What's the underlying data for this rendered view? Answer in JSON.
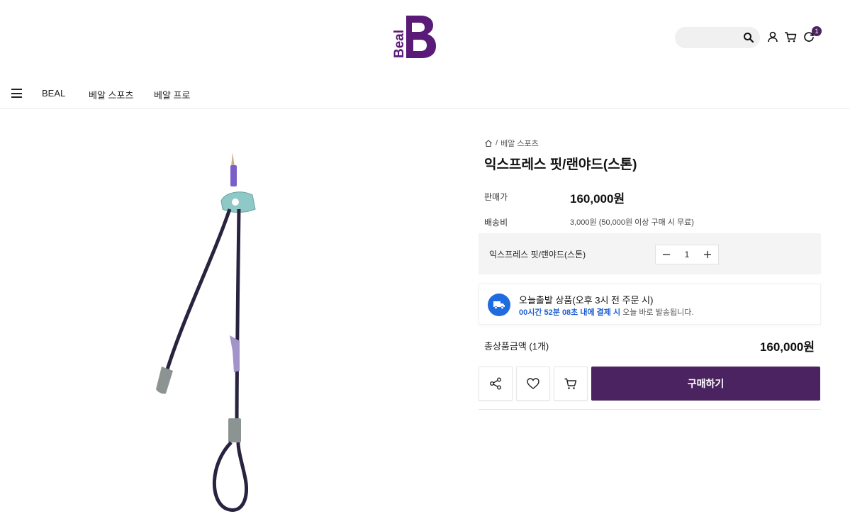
{
  "header": {
    "logo_text": "Beal",
    "search": {
      "placeholder": ""
    },
    "cart_badge": "1"
  },
  "nav": {
    "items": [
      {
        "label": "BEAL"
      },
      {
        "label": "베알 스포츠"
      },
      {
        "label": "베알 프로"
      }
    ]
  },
  "breadcrumb": {
    "separator": "/",
    "category": "베알 스포츠"
  },
  "product": {
    "title": "익스프레스 핏/랜야드(스톤)",
    "price_label": "판매가",
    "price": "160,000원",
    "shipping_label": "배송비",
    "shipping": "3,000원 (50,000원 이상 구매 시 무료)",
    "option_name": "익스프레스 핏/랜야드(스톤)",
    "quantity": "1"
  },
  "delivery": {
    "title": "오늘출발 상품(오후 3시 전 주문 시)",
    "countdown": "00시간 52분 08초 내에 결제 시",
    "suffix": " 오늘 바로 발송됩니다."
  },
  "total": {
    "label": "총상품금액 (1개)",
    "price": "160,000원"
  },
  "actions": {
    "buy_label": "구매하기"
  },
  "colors": {
    "brand": "#4b2360",
    "accent_blue": "#1f6be0"
  }
}
